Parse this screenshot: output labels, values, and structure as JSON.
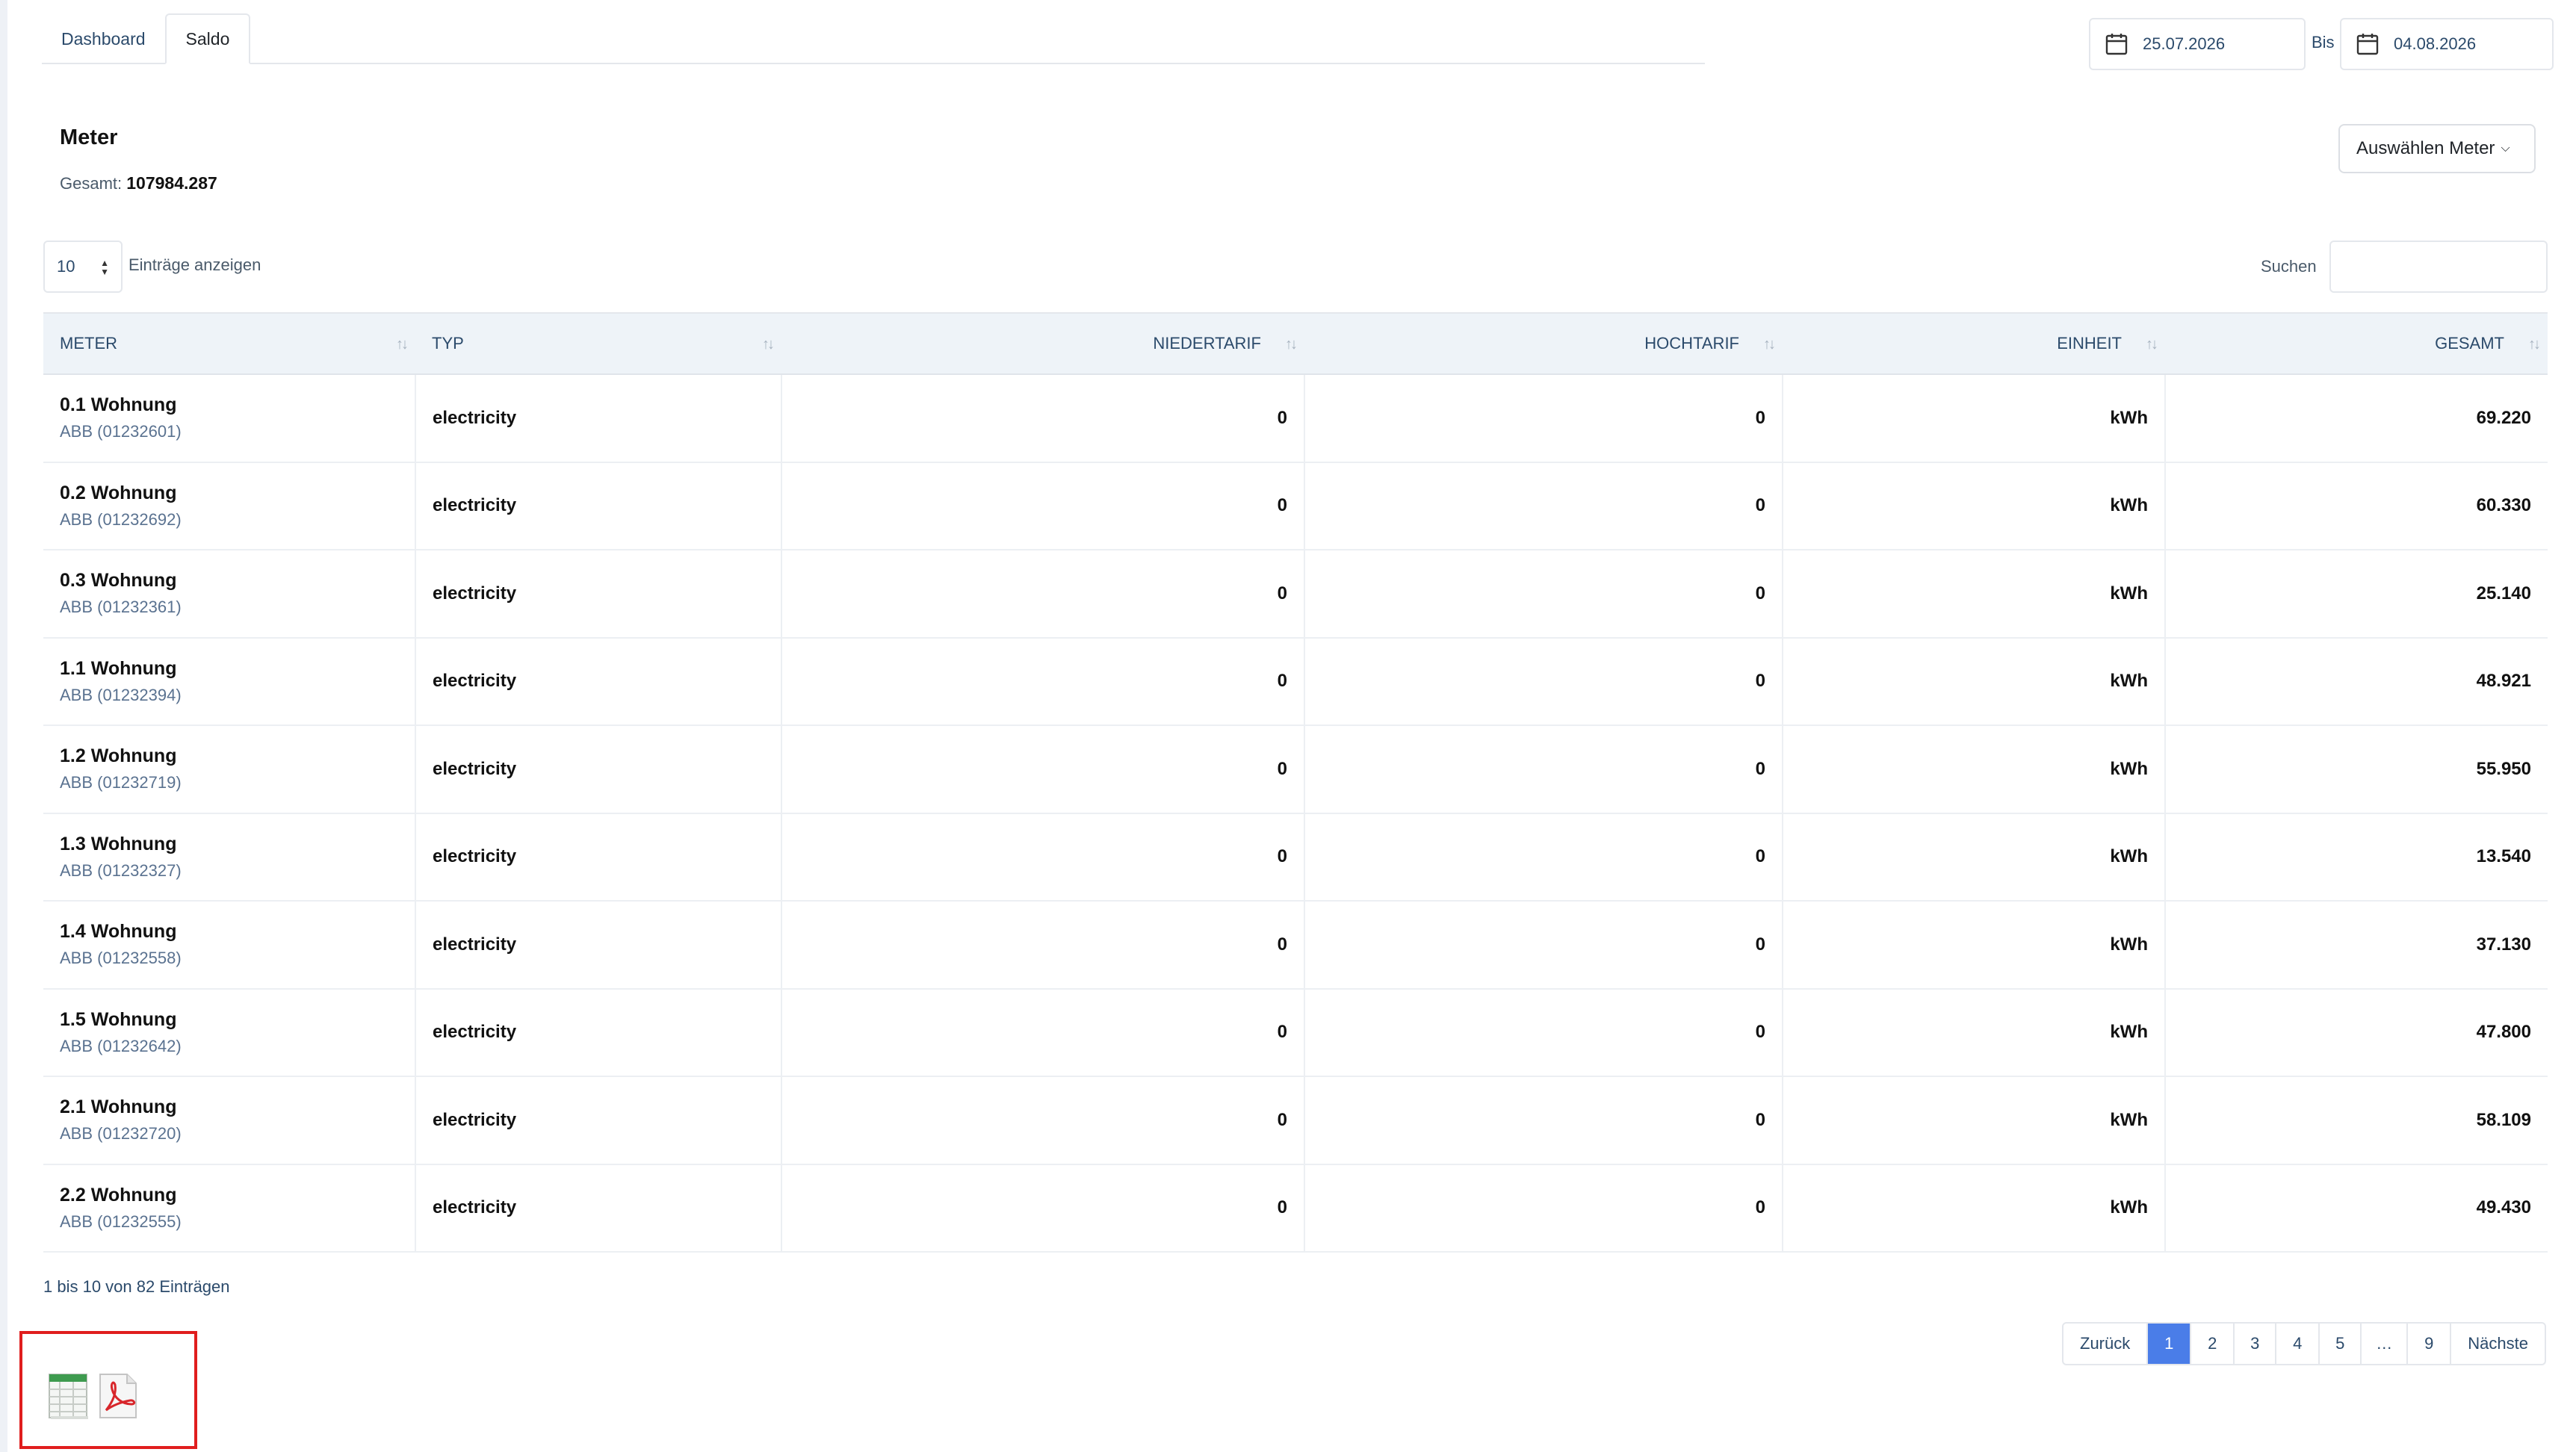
{
  "tabs": [
    {
      "label": "Dashboard",
      "active": false
    },
    {
      "label": "Saldo",
      "active": true
    }
  ],
  "date_range": {
    "from": "25.07.2026",
    "separator": "Bis",
    "to": "04.08.2026"
  },
  "meter": {
    "title": "Meter",
    "total_label": "Gesamt:",
    "total_value": "107984.287",
    "select_label": "Auswählen Meter"
  },
  "entries": {
    "count": "10",
    "label": "Einträge anzeigen"
  },
  "search": {
    "label": "Suchen",
    "value": ""
  },
  "table": {
    "columns": [
      "METER",
      "TYP",
      "NIEDERTARIF",
      "HOCHTARIF",
      "EINHEIT",
      "GESAMT"
    ],
    "rows": [
      {
        "name": "0.1 Wohnung",
        "device": "ABB (01232601)",
        "typ": "electricity",
        "nieder": "0",
        "hoch": "0",
        "einheit": "kWh",
        "gesamt": "69.220"
      },
      {
        "name": "0.2 Wohnung",
        "device": "ABB (01232692)",
        "typ": "electricity",
        "nieder": "0",
        "hoch": "0",
        "einheit": "kWh",
        "gesamt": "60.330"
      },
      {
        "name": "0.3 Wohnung",
        "device": "ABB (01232361)",
        "typ": "electricity",
        "nieder": "0",
        "hoch": "0",
        "einheit": "kWh",
        "gesamt": "25.140"
      },
      {
        "name": "1.1 Wohnung",
        "device": "ABB (01232394)",
        "typ": "electricity",
        "nieder": "0",
        "hoch": "0",
        "einheit": "kWh",
        "gesamt": "48.921"
      },
      {
        "name": "1.2 Wohnung",
        "device": "ABB (01232719)",
        "typ": "electricity",
        "nieder": "0",
        "hoch": "0",
        "einheit": "kWh",
        "gesamt": "55.950"
      },
      {
        "name": "1.3 Wohnung",
        "device": "ABB (01232327)",
        "typ": "electricity",
        "nieder": "0",
        "hoch": "0",
        "einheit": "kWh",
        "gesamt": "13.540"
      },
      {
        "name": "1.4 Wohnung",
        "device": "ABB (01232558)",
        "typ": "electricity",
        "nieder": "0",
        "hoch": "0",
        "einheit": "kWh",
        "gesamt": "37.130"
      },
      {
        "name": "1.5 Wohnung",
        "device": "ABB (01232642)",
        "typ": "electricity",
        "nieder": "0",
        "hoch": "0",
        "einheit": "kWh",
        "gesamt": "47.800"
      },
      {
        "name": "2.1 Wohnung",
        "device": "ABB (01232720)",
        "typ": "electricity",
        "nieder": "0",
        "hoch": "0",
        "einheit": "kWh",
        "gesamt": "58.109"
      },
      {
        "name": "2.2 Wohnung",
        "device": "ABB (01232555)",
        "typ": "electricity",
        "nieder": "0",
        "hoch": "0",
        "einheit": "kWh",
        "gesamt": "49.430"
      }
    ]
  },
  "info": "1 bis 10 von 82 Einträgen",
  "pagination": {
    "prev": "Zurück",
    "pages": [
      "1",
      "2",
      "3",
      "4",
      "5",
      "…",
      "9"
    ],
    "active": "1",
    "next": "Nächste"
  },
  "icons": {
    "calendar": "calendar-icon",
    "excel": "excel-export-icon",
    "pdf": "pdf-export-icon"
  },
  "colors": {
    "accent": "#4a7de8",
    "highlight_border": "#e01e1e",
    "header_bg": "#eef3f8"
  }
}
